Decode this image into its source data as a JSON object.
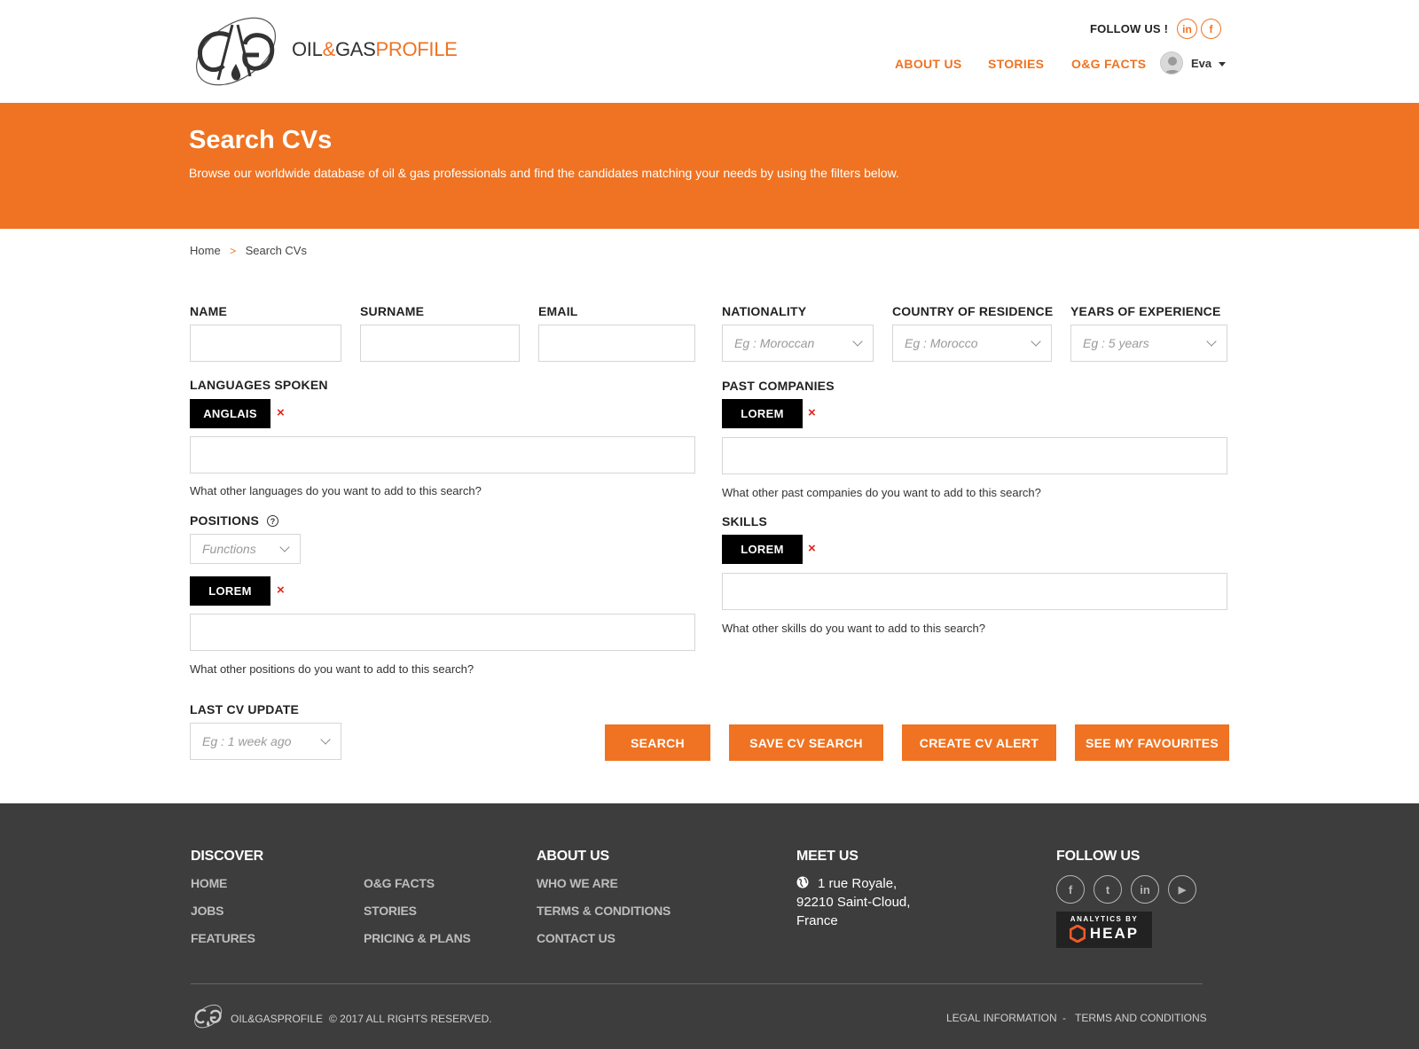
{
  "header": {
    "logo": {
      "oil": "OIL",
      "amp": "&",
      "gas": "GAS",
      "profile": "PROFILE"
    },
    "follow_us": "FOLLOW US !",
    "social": [
      {
        "icon": "linkedin-icon",
        "glyph": "in"
      },
      {
        "icon": "facebook-icon",
        "glyph": "f"
      }
    ],
    "nav": [
      {
        "label": "ABOUT US"
      },
      {
        "label": "STORIES"
      },
      {
        "label": "O&G FACTS"
      }
    ],
    "user": {
      "name": "Eva"
    }
  },
  "banner": {
    "title": "Search CVs",
    "description": "Browse our worldwide database of oil & gas professionals and find the candidates matching your needs by using the filters below."
  },
  "breadcrumb": {
    "home": "Home",
    "separator": ">",
    "current": "Search CVs"
  },
  "form": {
    "name": {
      "label": "NAME",
      "value": ""
    },
    "surname": {
      "label": "SURNAME",
      "value": ""
    },
    "email": {
      "label": "EMAIL",
      "value": ""
    },
    "nationality": {
      "label": "NATIONALITY",
      "placeholder": "Eg : Moroccan"
    },
    "country": {
      "label": "COUNTRY OF RESIDENCE",
      "placeholder": "Eg : Morocco"
    },
    "experience": {
      "label": "YEARS OF EXPERIENCE",
      "placeholder": "Eg : 5 years"
    },
    "languages": {
      "label": "LANGUAGES SPOKEN",
      "tags": [
        "ANGLAIS"
      ],
      "hint": "What other languages do you want to add to this search?"
    },
    "past_companies": {
      "label": "PAST COMPANIES",
      "tags": [
        "LOREM"
      ],
      "hint": "What other past companies do you want to add to this search?"
    },
    "positions": {
      "label": "POSITIONS",
      "help": "?",
      "functions_placeholder": "Functions",
      "tags": [
        "LOREM"
      ],
      "hint": "What other positions do you want to add to this search?"
    },
    "skills": {
      "label": "SKILLS",
      "tags": [
        "LOREM"
      ],
      "hint": "What other skills do you want to add to this search?"
    },
    "last_update": {
      "label": "LAST CV UPDATE",
      "placeholder": "Eg : 1 week ago"
    },
    "remove_glyph": "×"
  },
  "buttons": {
    "search": "SEARCH",
    "save": "SAVE CV SEARCH",
    "alert": "CREATE CV ALERT",
    "favourites": "SEE MY FAVOURITES"
  },
  "footer": {
    "discover": {
      "heading": "DISCOVER",
      "col1": [
        "HOME",
        "JOBS",
        "FEATURES"
      ],
      "col2": [
        "O&G FACTS",
        "STORIES",
        "PRICING & PLANS"
      ]
    },
    "about": {
      "heading": "ABOUT US",
      "links": [
        "WHO WE ARE",
        "TERMS & CONDITIONS",
        "CONTACT US"
      ]
    },
    "meet": {
      "heading": "MEET US",
      "address": [
        "1 rue Royale,",
        "92210 Saint-Cloud,",
        "France"
      ]
    },
    "follow": {
      "heading": "FOLLOW US",
      "social": [
        {
          "icon": "facebook-icon",
          "glyph": "f"
        },
        {
          "icon": "twitter-icon",
          "glyph": "t"
        },
        {
          "icon": "linkedin-icon",
          "glyph": "in"
        },
        {
          "icon": "youtube-icon",
          "glyph": "▶"
        }
      ]
    },
    "heap": {
      "top": "ANALYTICS BY",
      "main": "HEAP"
    },
    "bottom": {
      "logo_text": "OIL&GASPROFILE",
      "copyright": "© 2017 ALL RIGHTS RESERVED.",
      "legal": "LEGAL INFORMATION",
      "dash": "-",
      "terms": "TERMS AND CONDITIONS"
    }
  },
  "colors": {
    "accent": "#ef7322",
    "footer_bg": "#3d3d3d",
    "tag_bg": "#000000",
    "remove": "#e2231a"
  }
}
